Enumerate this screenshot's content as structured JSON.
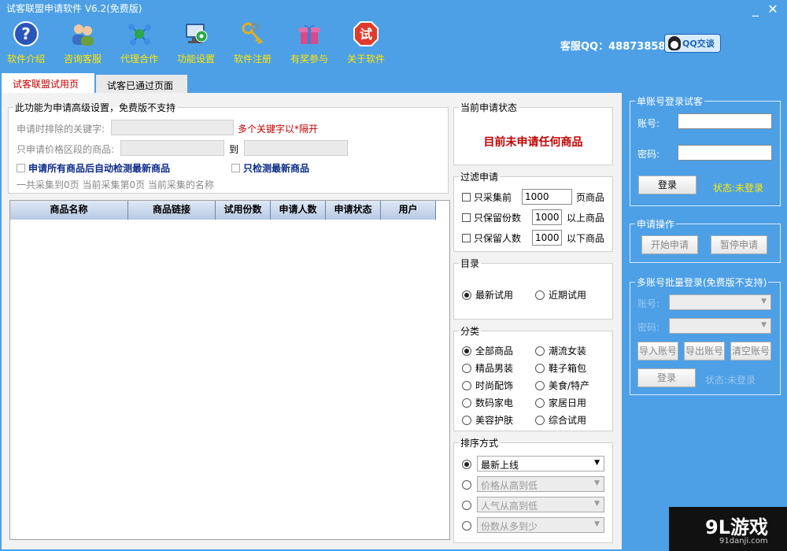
{
  "window": {
    "title": "试客联盟申请软件 V6.2(免费版)",
    "minimize": "_",
    "close": "✕"
  },
  "toolbar": [
    {
      "label": "软件介绍",
      "icon": "help-icon"
    },
    {
      "label": "咨询客服",
      "icon": "users-icon"
    },
    {
      "label": "代理合作",
      "icon": "network-icon"
    },
    {
      "label": "功能设置",
      "icon": "settings-icon"
    },
    {
      "label": "软件注册",
      "icon": "keys-icon"
    },
    {
      "label": "有奖参与",
      "icon": "gift-icon"
    },
    {
      "label": "关于软件",
      "icon": "shi-badge-icon"
    }
  ],
  "support": {
    "text": "客服QQ：488738580",
    "qq_button": "QQ交谈"
  },
  "tabs": [
    "试客联盟试用页面",
    "试客已通过页面"
  ],
  "advanced": {
    "legend": "此功能为申请高级设置，免费版不支持",
    "exclude_label": "申请时排除的关键字:",
    "exclude_hint": "多个关键字以*隔开",
    "price_label": "只申请价格区段的商品:",
    "price_to": "到",
    "auto_detect": "申请所有商品后自动检测最新商品",
    "only_detect": "只检测最新商品",
    "summary": "一共采集到0页  当前采集第0页  当前采集的名称"
  },
  "table": {
    "columns": [
      "商品名称",
      "商品链接",
      "试用份数",
      "申请人数",
      "申请状态",
      "用户"
    ],
    "rows": []
  },
  "current_status": {
    "legend": "当前申请状态",
    "message": "目前未申请任何商品"
  },
  "filter": {
    "legend": "过滤申请",
    "rows": [
      {
        "label": "只采集前",
        "value": "1000",
        "suffix": "页商品"
      },
      {
        "label": "只保留份数",
        "value": "1000",
        "suffix": "以上商品"
      },
      {
        "label": "只保留人数",
        "value": "1000",
        "suffix": "以下商品"
      }
    ]
  },
  "catalog": {
    "legend": "目录",
    "options": [
      "最新试用",
      "近期试用"
    ],
    "selected": "最新试用"
  },
  "category": {
    "legend": "分类",
    "options": [
      "全部商品",
      "潮流女装",
      "精品男装",
      "鞋子箱包",
      "时尚配饰",
      "美食/特产",
      "数码家电",
      "家居日用",
      "美容护肤",
      "综合试用"
    ],
    "selected": "全部商品"
  },
  "sort": {
    "legend": "排序方式",
    "options": [
      "最新上线",
      "价格从高到低",
      "人气从高到低",
      "份数从多到少"
    ],
    "selected": "最新上线"
  },
  "single_login": {
    "legend": "单账号登录试客",
    "account_label": "账号:",
    "password_label": "密码:",
    "login_button": "登录",
    "status": "状态:未登录"
  },
  "operations": {
    "legend": "申请操作",
    "start": "开始申请",
    "pause": "暂停申请"
  },
  "multi_login": {
    "legend": "多账号批量登录(免费版不支持)",
    "account_label": "账号:",
    "password_label": "密码:",
    "import": "导入账号",
    "export": "导出账号",
    "clear": "清空账号",
    "login_button": "登录",
    "status": "状态:未登录"
  },
  "watermark": {
    "brand": "9L游戏",
    "site": "91danji.com"
  },
  "colors": {
    "frame_blue": "#4da0e6",
    "toolbar_label": "#ffe600",
    "status_red": "#c00000",
    "status_yellow": "#ffea00"
  }
}
